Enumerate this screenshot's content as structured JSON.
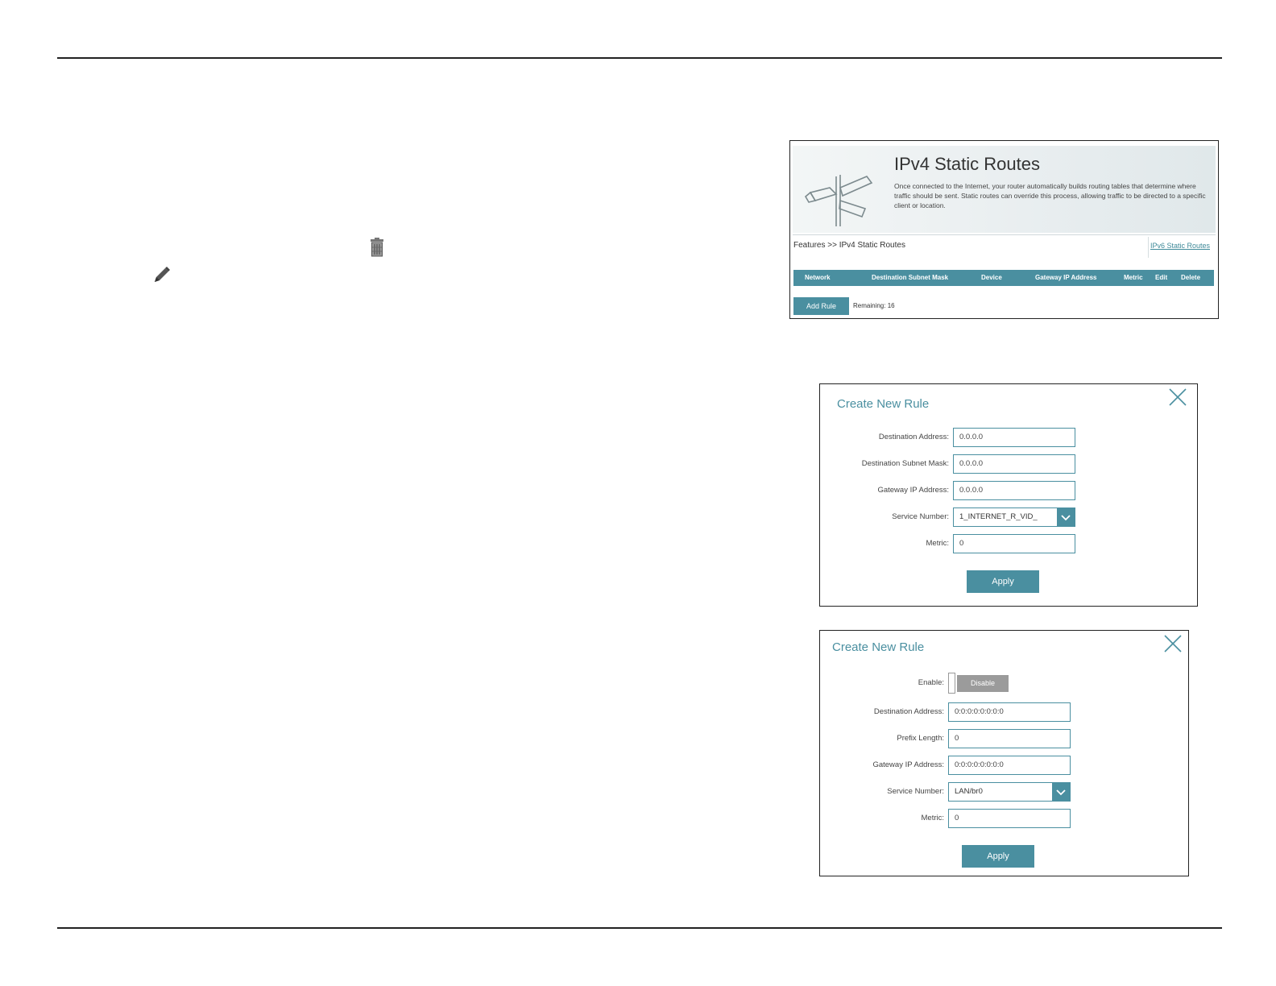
{
  "routes_panel": {
    "title": "IPv4 Static Routes",
    "description": "Once connected to the Internet, your router automatically builds routing tables that determine where traffic should be sent. Static routes can override this process, allowing traffic to be directed to a specific client or location.",
    "breadcrumb": "Features >> IPv4 Static Routes",
    "ipv6_link": "IPv6 Static Routes",
    "columns": [
      "Network",
      "Destination Subnet Mask",
      "Device",
      "Gateway IP Address",
      "Metric",
      "Edit",
      "Delete"
    ],
    "add_rule_label": "Add Rule",
    "remaining_text": "Remaining: 16",
    "accent_color": "#4a8fa0"
  },
  "dialog_ipv4": {
    "title": "Create New Rule",
    "fields": [
      {
        "label": "Destination Address:",
        "value": "0.0.0.0"
      },
      {
        "label": "Destination Subnet Mask:",
        "value": "0.0.0.0"
      },
      {
        "label": "Gateway IP Address:",
        "value": "0.0.0.0"
      },
      {
        "label": "Service Number:",
        "value": "1_INTERNET_R_VID_"
      },
      {
        "label": "Metric:",
        "value": "0"
      }
    ],
    "apply_label": "Apply"
  },
  "dialog_ipv6": {
    "title": "Create New Rule",
    "enable_label": "Enable:",
    "enable_state": "Disable",
    "fields": [
      {
        "label": "Destination Address:",
        "value": "0:0:0:0:0:0:0:0"
      },
      {
        "label": "Prefix Length:",
        "value": "0"
      },
      {
        "label": "Gateway IP Address:",
        "value": "0:0:0:0:0:0:0:0"
      },
      {
        "label": "Service Number:",
        "value": "LAN/br0"
      },
      {
        "label": "Metric:",
        "value": "0"
      }
    ],
    "apply_label": "Apply"
  },
  "icons": {
    "trash": "trash-icon",
    "pencil": "pencil-icon",
    "close": "close-icon",
    "chevron": "chevron-down-icon"
  }
}
